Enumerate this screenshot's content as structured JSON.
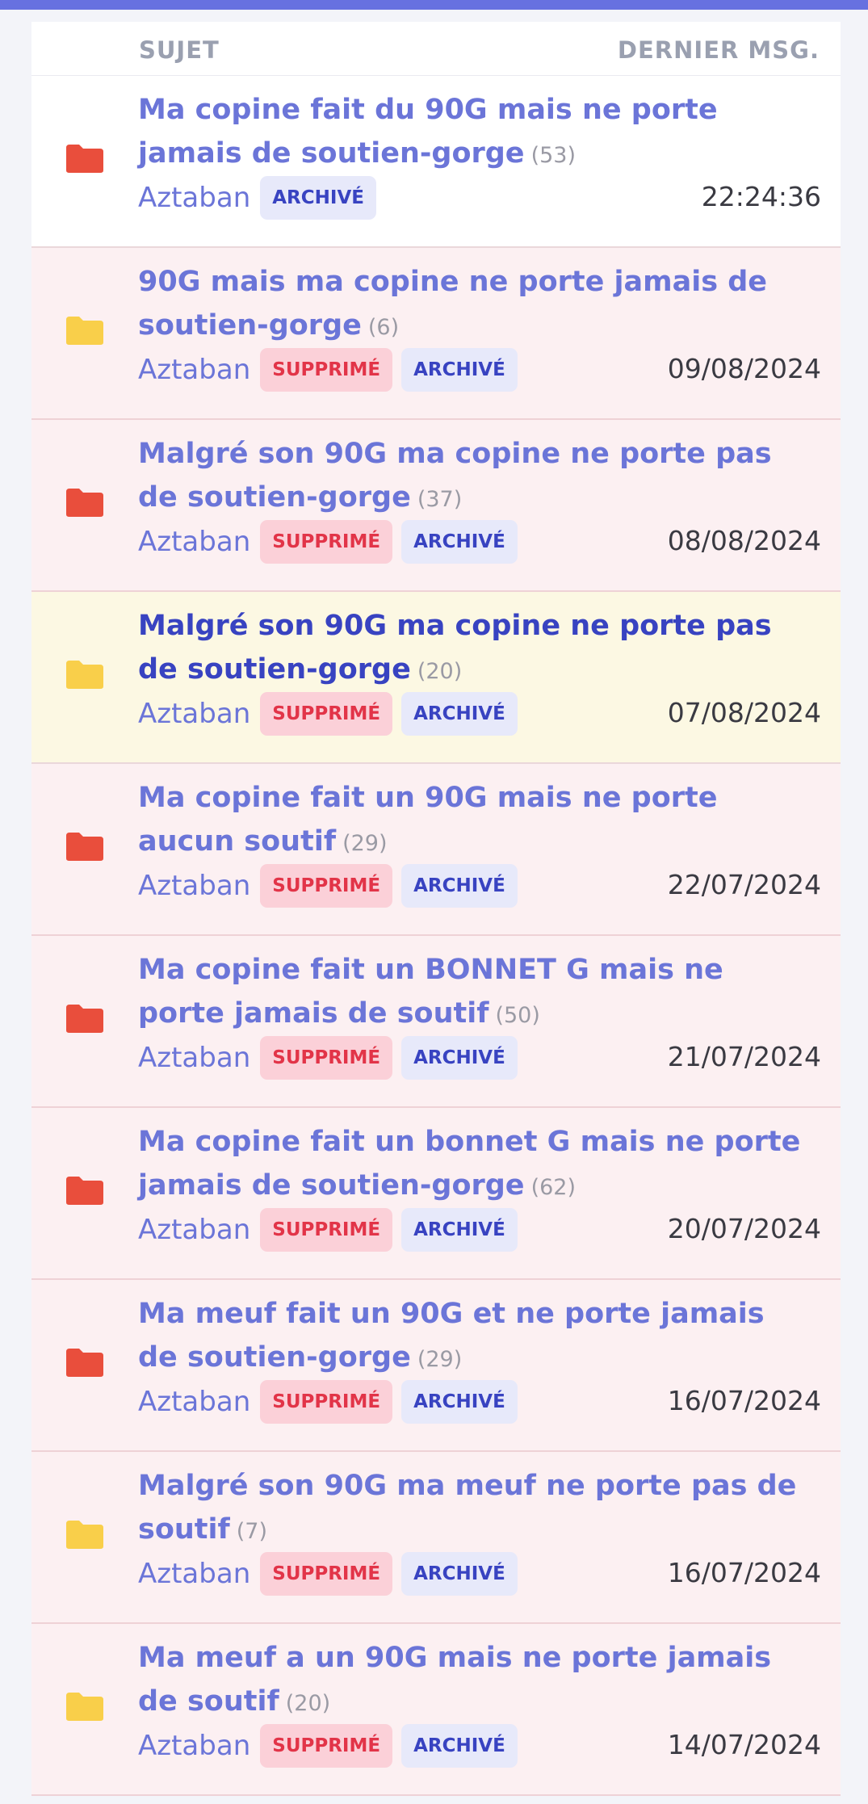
{
  "header": {
    "subject_label": "SUJET",
    "last_msg_label": "DERNIER MSG."
  },
  "colors": {
    "accent": "#6771e0",
    "folder_hot": "#e94e3c",
    "folder_normal": "#f9cf4a",
    "deleted_badge": "#e23448",
    "archived_badge": "#3843c1"
  },
  "topics": [
    {
      "title": "Ma copine fait du 90G mais ne porte jamais de soutien-gorge",
      "count": "(53)",
      "author": "Aztaban",
      "deleted": "",
      "archived": "ARCHIVÉ",
      "date": "22:24:36",
      "folder_icon": "folder-hot-icon"
    },
    {
      "title": "90G mais ma copine ne porte jamais de soutien-gorge",
      "count": "(6)",
      "author": "Aztaban",
      "deleted": "SUPPRIMÉ",
      "archived": "ARCHIVÉ",
      "date": "09/08/2024",
      "folder_icon": "folder-icon"
    },
    {
      "title": "Malgré son 90G ma copine ne porte pas de soutien-gorge",
      "count": "(37)",
      "author": "Aztaban",
      "deleted": "SUPPRIMÉ",
      "archived": "ARCHIVÉ",
      "date": "08/08/2024",
      "folder_icon": "folder-hot-icon"
    },
    {
      "title": "Malgré son 90G ma copine ne porte pas de soutien-gorge",
      "count": "(20)",
      "author": "Aztaban",
      "deleted": "SUPPRIMÉ",
      "archived": "ARCHIVÉ",
      "date": "07/08/2024",
      "folder_icon": "folder-icon"
    },
    {
      "title": "Ma copine fait un 90G mais ne porte aucun soutif",
      "count": "(29)",
      "author": "Aztaban",
      "deleted": "SUPPRIMÉ",
      "archived": "ARCHIVÉ",
      "date": "22/07/2024",
      "folder_icon": "folder-hot-icon"
    },
    {
      "title": "Ma copine fait un BONNET G mais ne porte jamais de soutif",
      "count": "(50)",
      "author": "Aztaban",
      "deleted": "SUPPRIMÉ",
      "archived": "ARCHIVÉ",
      "date": "21/07/2024",
      "folder_icon": "folder-hot-icon"
    },
    {
      "title": "Ma copine fait un bonnet G mais ne porte jamais de soutien-gorge",
      "count": "(62)",
      "author": "Aztaban",
      "deleted": "SUPPRIMÉ",
      "archived": "ARCHIVÉ",
      "date": "20/07/2024",
      "folder_icon": "folder-hot-icon"
    },
    {
      "title": "Ma meuf fait un 90G et ne porte jamais de soutien-gorge",
      "count": "(29)",
      "author": "Aztaban",
      "deleted": "SUPPRIMÉ",
      "archived": "ARCHIVÉ",
      "date": "16/07/2024",
      "folder_icon": "folder-hot-icon"
    },
    {
      "title": "Malgré son 90G ma meuf ne porte pas de soutif",
      "count": "(7)",
      "author": "Aztaban",
      "deleted": "SUPPRIMÉ",
      "archived": "ARCHIVÉ",
      "date": "16/07/2024",
      "folder_icon": "folder-icon"
    },
    {
      "title": "Ma meuf a un 90G mais ne porte jamais de soutif",
      "count": "(20)",
      "author": "Aztaban",
      "deleted": "SUPPRIMÉ",
      "archived": "ARCHIVÉ",
      "date": "14/07/2024",
      "folder_icon": "folder-icon"
    }
  ]
}
